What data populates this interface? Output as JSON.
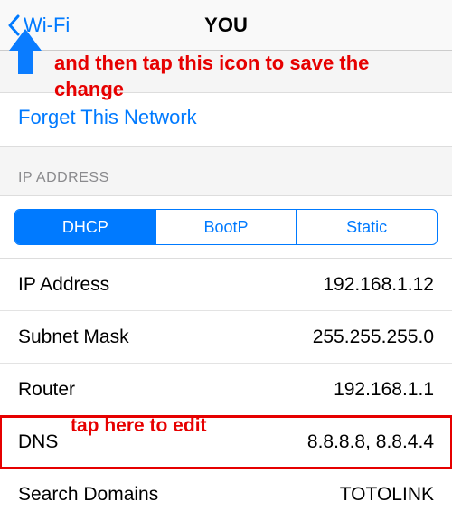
{
  "nav": {
    "back_label": "Wi-Fi",
    "title": "YOU"
  },
  "annotations": {
    "save_hint": "and then tap this icon to save the change",
    "dns_hint": "tap here to edit"
  },
  "forget": {
    "label": "Forget This Network"
  },
  "ip_section": {
    "header": "IP ADDRESS",
    "tabs": {
      "dhcp": "DHCP",
      "bootp": "BootP",
      "static": "Static",
      "active": "dhcp"
    },
    "rows": {
      "ip": {
        "label": "IP Address",
        "value": "192.168.1.12"
      },
      "mask": {
        "label": "Subnet Mask",
        "value": "255.255.255.0"
      },
      "router": {
        "label": "Router",
        "value": "192.168.1.1"
      },
      "dns": {
        "label": "DNS",
        "value": "8.8.8.8, 8.8.4.4"
      },
      "search": {
        "label": "Search Domains",
        "value": "TOTOLINK"
      }
    }
  }
}
